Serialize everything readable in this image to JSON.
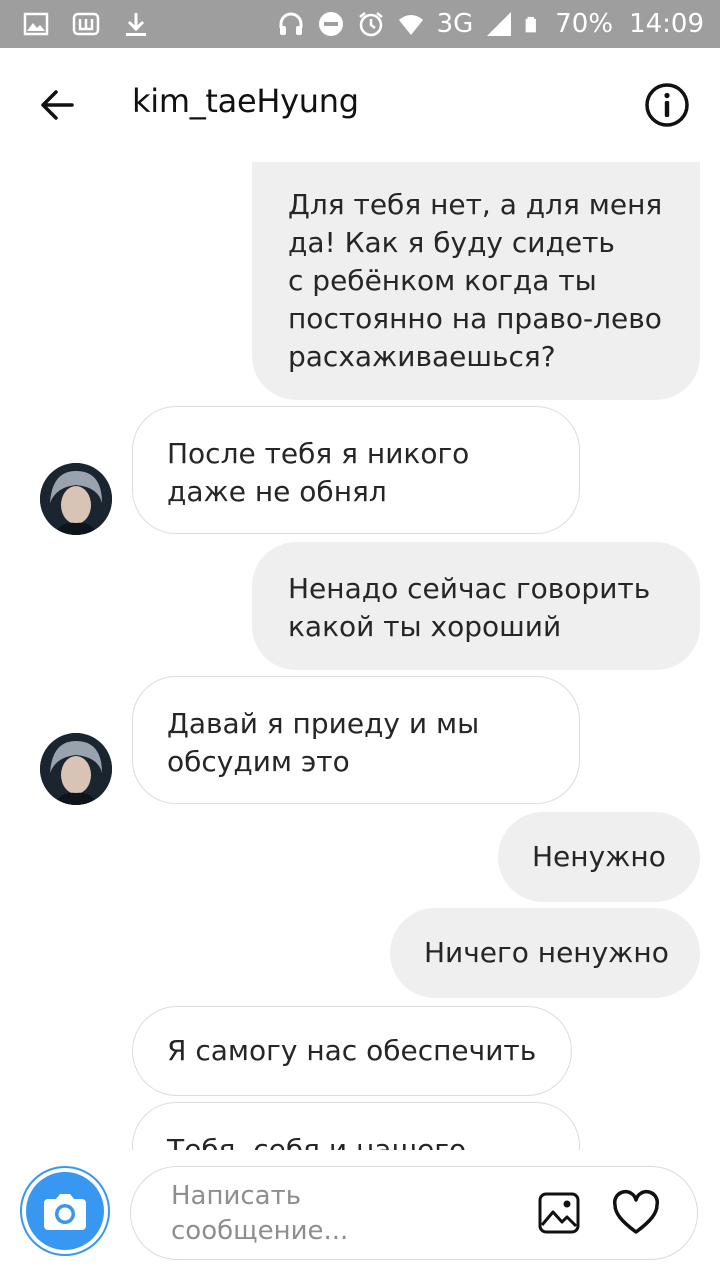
{
  "status_bar": {
    "network": "3G",
    "battery": "70%",
    "time": "14:09",
    "icons": [
      "image-icon",
      "app-icon",
      "download-icon",
      "headphones-icon",
      "dnd-icon",
      "alarm-icon",
      "wifi-icon",
      "signal-icon",
      "battery-icon"
    ]
  },
  "header": {
    "title": "kim_taeHyung",
    "back_icon": "arrow-left-icon",
    "info_icon": "info-icon"
  },
  "messages": [
    {
      "side": "out",
      "text": "Для тебя нет, а для меня\nда! Как я буду сидеть\nс ребёнком когда ты\nпостоянно на право-лево\nрасхаживаешься?"
    },
    {
      "side": "in",
      "text": "После тебя я никого\nдаже не обнял"
    },
    {
      "side": "out",
      "text": "Ненадо сейчас говорить\nкакой ты хороший"
    },
    {
      "side": "in",
      "text": "Давай я приеду и мы\nобсудим это"
    },
    {
      "side": "out",
      "text": "Ненужно"
    },
    {
      "side": "out",
      "text": "Ничего ненужно"
    },
    {
      "side": "in",
      "text": "Я самогу нас обеспечить"
    },
    {
      "side": "in",
      "text": "Тебя, себя и нашего"
    }
  ],
  "composer": {
    "placeholder": "Написать\nсообщение...",
    "camera_icon": "camera-icon",
    "gallery_icon": "gallery-icon",
    "like_icon": "heart-icon"
  },
  "colors": {
    "accent": "#3897f0",
    "status_bar": "#9e9e9e",
    "outgoing_bubble": "#efefef",
    "incoming_border": "#dcdcdc"
  }
}
